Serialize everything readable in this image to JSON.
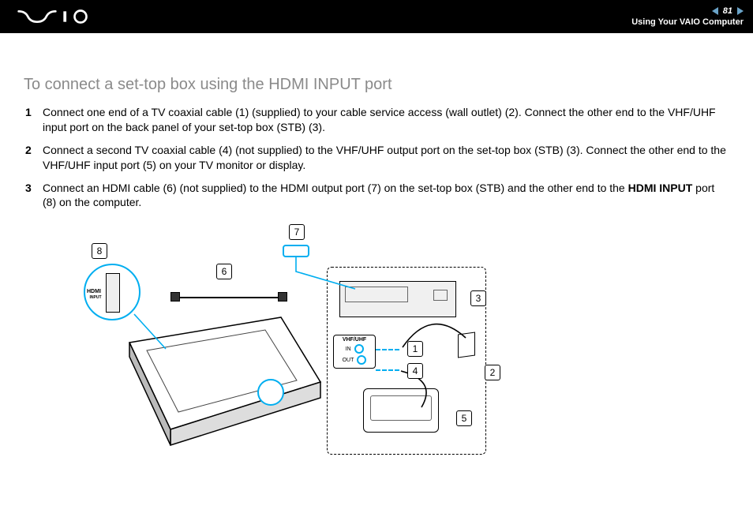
{
  "header": {
    "page_number": "81",
    "section_label": "Using Your VAIO Computer"
  },
  "title": "To connect a set-top box using the HDMI INPUT port",
  "steps": [
    {
      "prefix": "Connect one end of a TV coaxial cable (1) (supplied) to your cable service access (wall outlet) (2). Connect the other end to the VHF/UHF input port on the back panel of your set-top box (STB) (3).",
      "bold": "",
      "suffix": ""
    },
    {
      "prefix": "Connect a second TV coaxial cable (4) (not supplied) to the VHF/UHF output port on the set-top box (STB) (3). Connect the other end to the VHF/UHF input port (5) on your TV monitor or display.",
      "bold": "",
      "suffix": ""
    },
    {
      "prefix": "Connect an HDMI cable (6) (not supplied) to the HDMI output port (7) on the set-top box (STB) and the other end to the ",
      "bold": "HDMI INPUT",
      "suffix": " port (8) on the computer."
    }
  ],
  "diagram": {
    "labels": {
      "l1": "1",
      "l2": "2",
      "l3": "3",
      "l4": "4",
      "l5": "5",
      "l6": "6",
      "l7": "7",
      "l8": "8"
    },
    "vhfuhf": {
      "title": "VHF/UHF",
      "in": "IN",
      "out": "OUT"
    },
    "hdmi_input_text": "INPUT"
  }
}
